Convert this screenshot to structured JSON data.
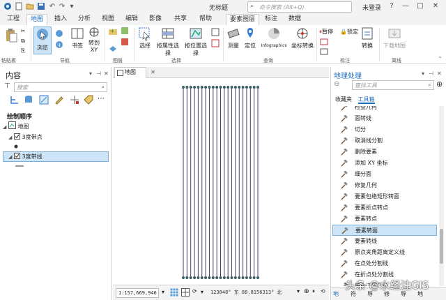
{
  "titlebar": {
    "doc_title": "无标题",
    "search_placeholder": "命令搜索 (Alt+Q)",
    "signin": "未登录",
    "help": "?",
    "minimize": "—",
    "maximize": "□",
    "close": "✕"
  },
  "tabs": [
    "工程",
    "地图",
    "插入",
    "分析",
    "视图",
    "编辑",
    "影像",
    "共享",
    "帮助",
    "要素图层",
    "标注",
    "数据"
  ],
  "ribbon": {
    "paste_label": "粘贴板",
    "explore": "浏览",
    "bookmark": "书签",
    "goto_xy_1": "转到",
    "goto_xy_2": "XY",
    "nav_label": "导航",
    "layer_label": "图层",
    "select": "选择",
    "select_by_attr": "按属性选择",
    "select_by_loc": "按位置选择",
    "select_group": "选择",
    "measure": "测量",
    "locate": "定位",
    "infographics": "Infographics",
    "coord_convert": "坐标转换",
    "query_group": "查询",
    "pause": "暂停",
    "lock": "锁定",
    "convert": "转换",
    "label_group": "标注",
    "download_map": "下载地图",
    "offline_group": "离线"
  },
  "content": {
    "title": "内容",
    "search_placeholder": "搜索",
    "draw_order": "绘制顺序",
    "map_node": "地图",
    "layer1": "3度带点",
    "layer2": "3度带线"
  },
  "map": {
    "tab_label": "地图",
    "scale": "1:157,669,946",
    "coords": "123848° 东  88.8156313° 北"
  },
  "gp": {
    "title": "地理处理",
    "search_placeholder": "查找工具",
    "tab_favorites": "收藏夹",
    "tab_toolbox": "工具箱",
    "tools": [
      "检查几何",
      "面转线",
      "切分",
      "取消线分割",
      "删除要素",
      "添加 XY 坐标",
      "细分面",
      "修复几何",
      "要素包络矩形转面",
      "要素折点转点",
      "要素转点",
      "要素转面",
      "要素转线",
      "原点夹角距离定义线",
      "在点处分割线",
      "在折点处分割线",
      "最小边界几何"
    ],
    "selected_index": 11,
    "bottom_tabs": [
      "地",
      "符",
      "导",
      "修",
      "导",
      "地"
    ]
  },
  "watermark": "头条 @水经注GIS",
  "colors": {
    "accent": "#1f6fbf",
    "line": "#4a3a6e",
    "node": "#3d5f64",
    "selection": "#cde4f7"
  }
}
